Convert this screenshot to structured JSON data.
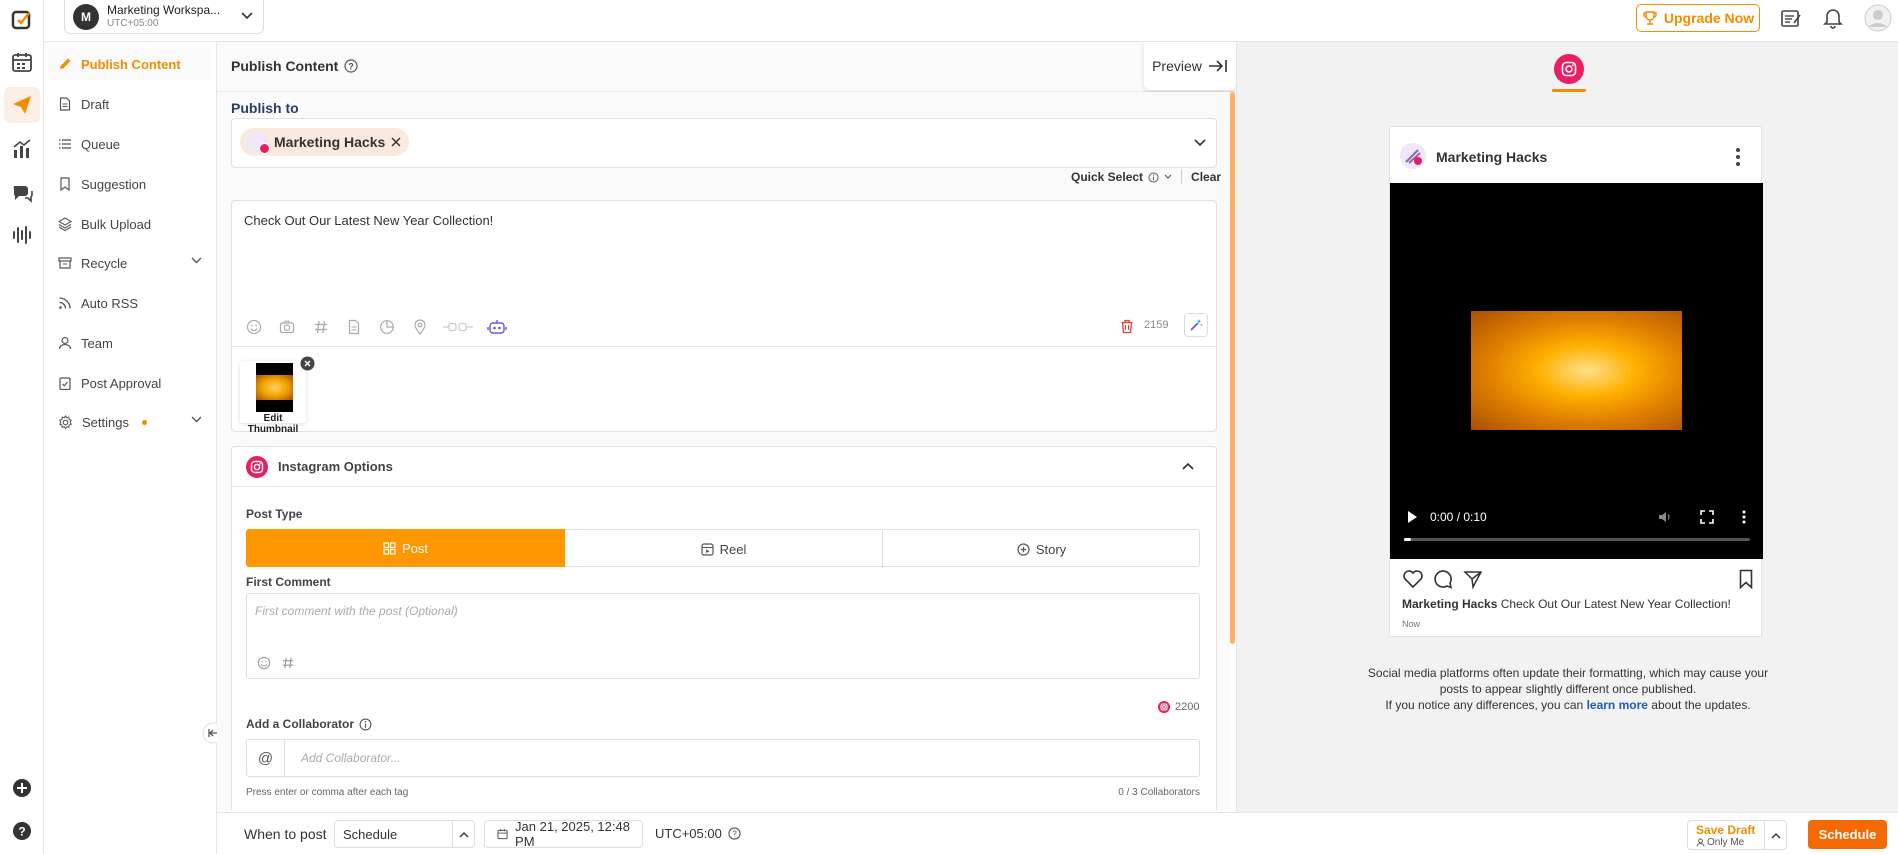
{
  "colors": {
    "accent": "#f28c00",
    "instagram": "#e91e63",
    "link": "#1e5bb8"
  },
  "workspace": {
    "initial": "M",
    "name": "Marketing Workspa...",
    "timezone": "UTC+05:00"
  },
  "topbar": {
    "upgrade_label": "Upgrade Now"
  },
  "sidebar": {
    "items": [
      {
        "label": "Publish Content",
        "icon": "pencil-icon"
      },
      {
        "label": "Draft",
        "icon": "document-icon"
      },
      {
        "label": "Queue",
        "icon": "list-icon"
      },
      {
        "label": "Suggestion",
        "icon": "bookmark-icon"
      },
      {
        "label": "Bulk Upload",
        "icon": "layers-icon"
      },
      {
        "label": "Recycle",
        "icon": "archive-icon"
      },
      {
        "label": "Auto RSS",
        "icon": "rss-icon"
      },
      {
        "label": "Team",
        "icon": "user-icon"
      },
      {
        "label": "Post Approval",
        "icon": "clipboard-check-icon"
      },
      {
        "label": "Settings",
        "icon": "gear-icon"
      }
    ]
  },
  "header": {
    "title": "Publish Content",
    "preview_label": "Preview"
  },
  "publish_to": {
    "label": "Publish to",
    "account": "Marketing Hacks",
    "quick_select": "Quick Select",
    "clear": "Clear"
  },
  "editor": {
    "text": "Check Out Our Latest New Year Collection!",
    "char_count": "2159",
    "thumbnail_label": "Edit Thumbnail"
  },
  "instagram_options": {
    "title": "Instagram Options",
    "post_type_label": "Post Type",
    "post_types": [
      "Post",
      "Reel",
      "Story"
    ],
    "selected_post_type": "Post",
    "first_comment_label": "First Comment",
    "first_comment_placeholder": "First comment with the post (Optional)",
    "first_comment_count": "2200",
    "collaborator_label": "Add a Collaborator",
    "collaborator_placeholder": "Add Collaborator...",
    "collaborator_hint": "Press enter or comma after each tag",
    "collaborator_count": "0 / 3 Collaborators"
  },
  "bottom": {
    "when_label": "When to post",
    "schedule_option": "Schedule",
    "datetime": "Jan 21, 2025, 12:48 PM",
    "timezone": "UTC+05:00",
    "save_draft": "Save Draft",
    "visibility": "Only Me",
    "schedule_button": "Schedule"
  },
  "preview": {
    "account": "Marketing Hacks",
    "video_time": "0:00 / 0:10",
    "video_progress": 0.02,
    "caption_author": "Marketing Hacks",
    "caption_text": "Check Out Our Latest New Year Collection!",
    "time": "Now",
    "notice_line1": "Social media platforms often update their formatting, which may cause your",
    "notice_line2": "posts to appear slightly different once published.",
    "notice_line3_pre": "If you notice any differences, you can",
    "notice_link": "learn more",
    "notice_line3_post": "about the updates."
  }
}
